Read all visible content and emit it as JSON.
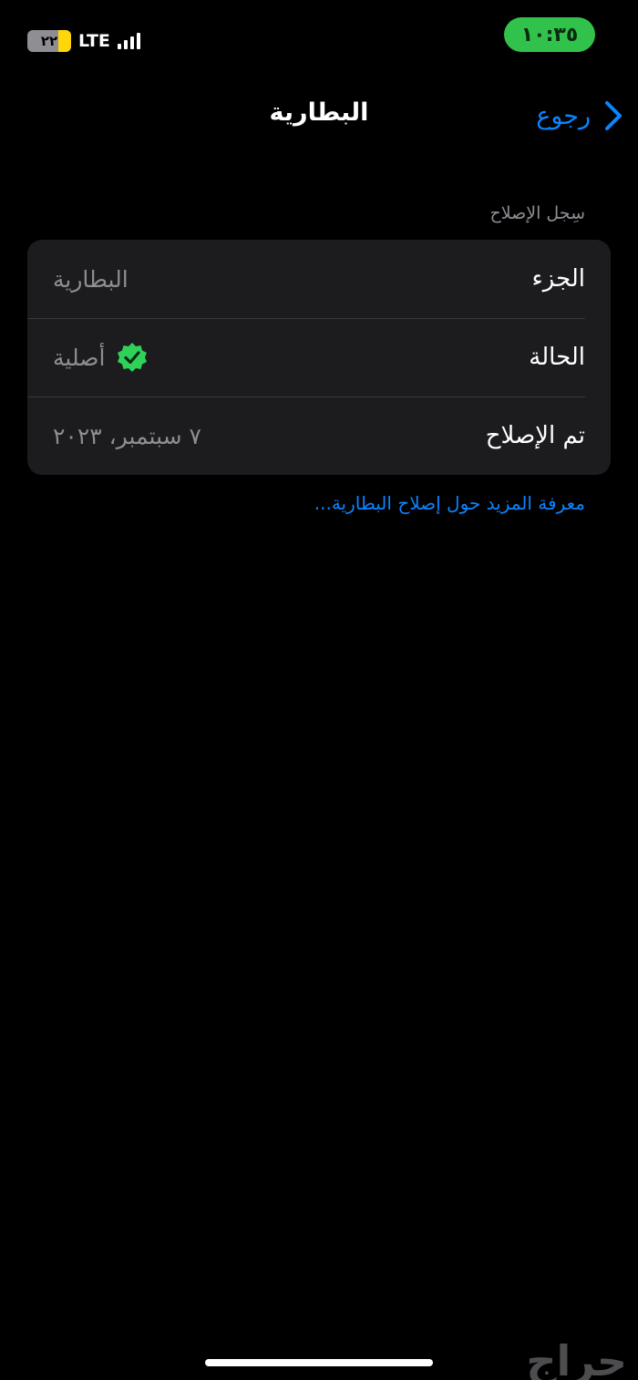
{
  "status_bar": {
    "time": "١٠:٣٥",
    "battery_level": "٢٢",
    "network": "LTE",
    "time_pill_color": "#30c24b"
  },
  "nav": {
    "back_label": "رجوع",
    "title": "البطارية"
  },
  "section": {
    "header": "سِجل الإصلاح",
    "rows": [
      {
        "label": "الجزء",
        "value": "البطارية"
      },
      {
        "label": "الحالة",
        "value": "أصلية",
        "icon": "verified-badge-icon"
      },
      {
        "label": "تم الإصلاح",
        "value": "٧ سبتمبر، ٢٠٢٣"
      }
    ]
  },
  "learn_more": "معرفة المزيد حول إصلاح البطارية...",
  "watermark": "حراج",
  "colors": {
    "accent": "#0a84ff",
    "badge": "#30d158",
    "card": "#1c1c1e"
  }
}
